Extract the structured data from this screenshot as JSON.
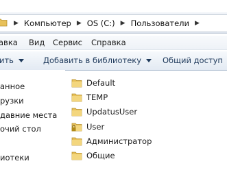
{
  "address_bar": {
    "breadcrumbs": [
      "Компьютер",
      "OS (C:)",
      "Пользователи"
    ]
  },
  "menu_bar": {
    "items": [
      "авка",
      "Вид",
      "Сервис",
      "Справка"
    ]
  },
  "toolbar": {
    "items": [
      "ить",
      "Добавить в библиотеку",
      "Общий доступ"
    ]
  },
  "navigation_pane": {
    "items": [
      "анное",
      "рузки",
      "давние места",
      "очий стол",
      "иотеки"
    ]
  },
  "file_list": {
    "items": [
      {
        "name": "Default",
        "icon": "folder-icon"
      },
      {
        "name": "TEMP",
        "icon": "folder-icon"
      },
      {
        "name": "UpdatusUser",
        "icon": "folder-icon"
      },
      {
        "name": "User",
        "icon": "locked-folder-icon"
      },
      {
        "name": "Администратор",
        "icon": "folder-icon"
      },
      {
        "name": "Общие",
        "icon": "folder-icon"
      }
    ]
  },
  "colors": {
    "folder": "#e8c15a",
    "toolbar_text": "#1e395b",
    "lock": "#b08a1a"
  }
}
